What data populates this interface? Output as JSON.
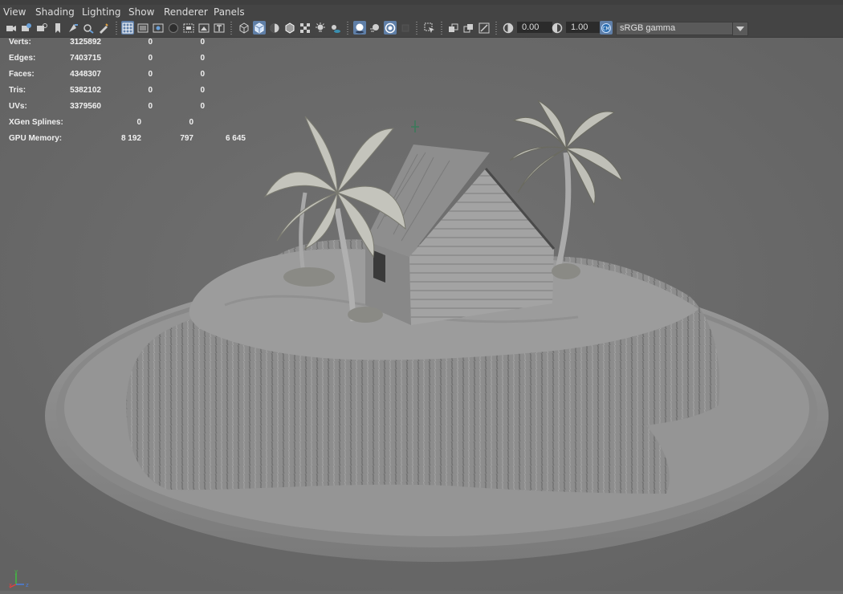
{
  "menu": [
    "View",
    "Shading",
    "Lighting",
    "Show",
    "Renderer",
    "Panels"
  ],
  "toolbar": {
    "exposure": "0.00",
    "gamma": "1.00",
    "colorspace": "sRGB gamma"
  },
  "hud": {
    "rows": [
      {
        "label": "Verts:",
        "v1": "3125892",
        "v2": "0",
        "v3": "0"
      },
      {
        "label": "Edges:",
        "v1": "7403715",
        "v2": "0",
        "v3": "0"
      },
      {
        "label": "Faces:",
        "v1": "4348307",
        "v2": "0",
        "v3": "0"
      },
      {
        "label": "Tris:",
        "v1": "5382102",
        "v2": "0",
        "v3": "0"
      },
      {
        "label": "UVs:",
        "v1": "3379560",
        "v2": "0",
        "v3": "0"
      }
    ],
    "xgen": {
      "label": "XGen Splines:",
      "v1": "0",
      "v2": "0"
    },
    "gpu": {
      "label": "GPU Memory:",
      "v1": "8 192",
      "v2": "797",
      "v3": "6 645"
    }
  },
  "axis": {
    "x": "x",
    "y": "y",
    "z": "z"
  },
  "colors": {
    "active": "#5f7fa8",
    "background": "#6a6a6a",
    "panel": "#444444"
  }
}
